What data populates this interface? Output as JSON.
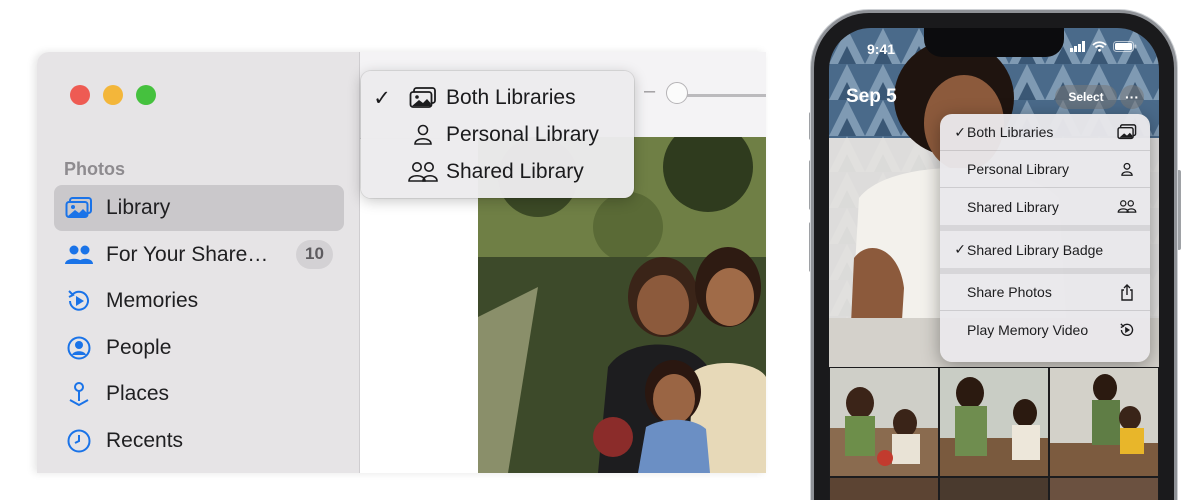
{
  "mac": {
    "sidebar": {
      "section_title": "Photos",
      "items": [
        {
          "label": "Library",
          "icon": "library-icon",
          "selected": true
        },
        {
          "label": "For Your Share…",
          "icon": "people-icon",
          "badge": "10"
        },
        {
          "label": "Memories",
          "icon": "memories-icon"
        },
        {
          "label": "People",
          "icon": "person-circle-icon"
        },
        {
          "label": "Places",
          "icon": "pin-icon"
        },
        {
          "label": "Recents",
          "icon": "clock-icon"
        }
      ]
    },
    "toolbar": {
      "zoom_minus": "–"
    },
    "library_menu": {
      "items": [
        {
          "label": "Both Libraries",
          "checked": true,
          "check": "✓",
          "icon": "photos-stack-icon"
        },
        {
          "label": "Personal Library",
          "checked": false,
          "check": "",
          "icon": "person-icon"
        },
        {
          "label": "Shared Library",
          "checked": false,
          "check": "",
          "icon": "two-people-icon"
        }
      ]
    }
  },
  "iphone": {
    "status": {
      "time": "9:41"
    },
    "date": "Sep 5",
    "select_label": "Select",
    "more_label": "···",
    "menu": {
      "items": [
        {
          "label": "Both Libraries",
          "check": "✓",
          "icon": "photos-stack-icon"
        },
        {
          "label": "Personal Library",
          "check": "",
          "icon": "person-icon"
        },
        {
          "label": "Shared Library",
          "check": "",
          "icon": "two-people-icon"
        },
        {
          "label": "Shared Library Badge",
          "check": "✓",
          "icon": ""
        },
        {
          "label": "Share Photos",
          "check": "",
          "icon": "share-icon"
        },
        {
          "label": "Play Memory Video",
          "check": "",
          "icon": "memory-play-icon"
        }
      ]
    }
  },
  "colors": {
    "accent_blue": "#1a73e8",
    "traffic_red": "#ee5b53",
    "traffic_yellow": "#f3b63a",
    "traffic_green": "#45c13e"
  }
}
